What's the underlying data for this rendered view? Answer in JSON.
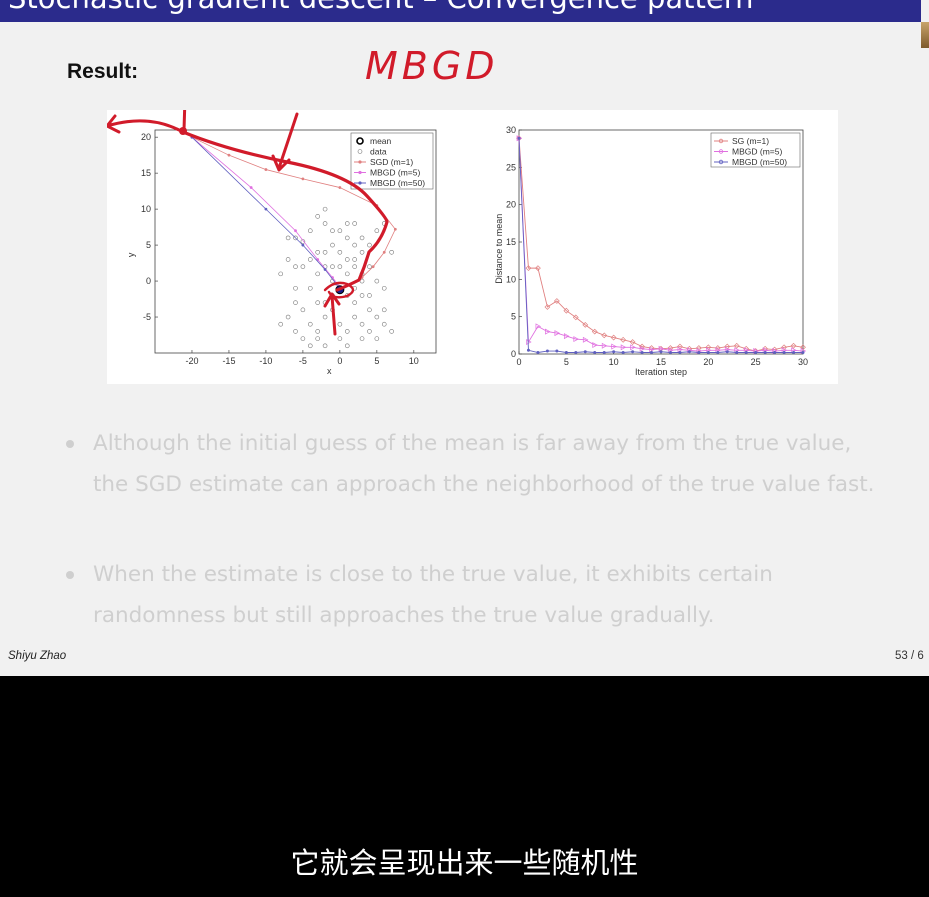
{
  "slide": {
    "title": "Stochastic gradient descent – Convergence pattern",
    "result_label": "Result:",
    "handwritten_note": "MBGD",
    "bullets": [
      "Although the initial guess of the mean is far away from the true value, the SGD estimate can approach the neighborhood of the true value fast.",
      "When the estimate is close to the true value, it exhibits certain randomness but still approaches the true value gradually."
    ],
    "author": "Shiyu Zhao",
    "page": "53 / 6"
  },
  "subtitle": "它就会呈现出来一些随机性",
  "colors": {
    "title_bar": "#2b2b8c",
    "sgd": "#e08080",
    "mbgd5": "#e070e0",
    "mbgd50": "#6060c0",
    "annotation": "#d11b2a"
  },
  "chart_data": [
    {
      "type": "scatter",
      "xlabel": "x",
      "ylabel": "y",
      "xlim": [
        -25,
        13
      ],
      "ylim": [
        -10,
        21
      ],
      "xticks": [
        -20,
        -15,
        -10,
        -5,
        0,
        5,
        10
      ],
      "yticks": [
        -5,
        0,
        5,
        10,
        15,
        20
      ],
      "legend_position": "top-right",
      "legend": [
        "mean",
        "data",
        "SGD (m=1)",
        "MBGD (m=5)",
        "MBGD (m=50)"
      ],
      "mean": [
        0,
        -1.2
      ],
      "data": [
        [
          -6,
          6
        ],
        [
          -5,
          5.5
        ],
        [
          -4,
          7
        ],
        [
          -3,
          9
        ],
        [
          -2,
          8
        ],
        [
          -1,
          7
        ],
        [
          0,
          7
        ],
        [
          1,
          6
        ],
        [
          2,
          5
        ],
        [
          3,
          6
        ],
        [
          -1,
          5
        ],
        [
          -2,
          4
        ],
        [
          -3,
          4
        ],
        [
          -4,
          3
        ],
        [
          1,
          3
        ],
        [
          2,
          3
        ],
        [
          3,
          4
        ],
        [
          4,
          5
        ],
        [
          5,
          7
        ],
        [
          6,
          8
        ],
        [
          -6,
          2
        ],
        [
          -5,
          2
        ],
        [
          -2,
          2
        ],
        [
          0,
          2
        ],
        [
          1,
          1
        ],
        [
          2,
          2
        ],
        [
          3,
          1
        ],
        [
          4,
          2
        ],
        [
          -8,
          1
        ],
        [
          -7,
          3
        ],
        [
          5,
          0
        ],
        [
          6,
          -1
        ],
        [
          -3,
          1
        ],
        [
          -1,
          0
        ],
        [
          0,
          -1
        ],
        [
          1,
          -2
        ],
        [
          2,
          -1
        ],
        [
          3,
          0
        ],
        [
          -6,
          -3
        ],
        [
          -5,
          -4
        ],
        [
          -4,
          -6
        ],
        [
          -3,
          -7
        ],
        [
          -2,
          -5
        ],
        [
          -1,
          -4
        ],
        [
          0,
          -6
        ],
        [
          1,
          -7
        ],
        [
          2,
          -5
        ],
        [
          3,
          -6
        ],
        [
          4,
          -4
        ],
        [
          5,
          -5
        ],
        [
          6,
          -4
        ],
        [
          -6,
          -7
        ],
        [
          -5,
          -8
        ],
        [
          -4,
          -9
        ],
        [
          -3,
          -8
        ],
        [
          -2,
          -9
        ],
        [
          0,
          -8
        ],
        [
          1,
          -9
        ],
        [
          3,
          -8
        ],
        [
          4,
          -7
        ],
        [
          5,
          -8
        ],
        [
          6,
          -6
        ],
        [
          -7,
          -5
        ],
        [
          -8,
          -6
        ],
        [
          7,
          -7
        ],
        [
          -1,
          -2
        ],
        [
          -2,
          -3
        ],
        [
          2,
          -3
        ],
        [
          -4,
          -1
        ],
        [
          4,
          -2
        ],
        [
          -7,
          6
        ],
        [
          7,
          4
        ],
        [
          -6,
          -1
        ],
        [
          -2,
          10
        ],
        [
          1,
          8
        ],
        [
          3,
          -2
        ],
        [
          -3,
          -3
        ],
        [
          0,
          4
        ],
        [
          -1,
          2
        ],
        [
          2,
          8
        ]
      ],
      "series": [
        {
          "name": "SGD (m=1)",
          "points": [
            [
              -20,
              20
            ],
            [
              -15,
              17.5
            ],
            [
              -10,
              15.5
            ],
            [
              -5,
              14.2
            ],
            [
              0,
              13
            ],
            [
              5,
              10.5
            ],
            [
              7.5,
              7.2
            ],
            [
              6,
              4
            ],
            [
              4.5,
              2
            ],
            [
              3,
              0.5
            ],
            [
              1,
              -0.5
            ],
            [
              0,
              -1.2
            ]
          ]
        },
        {
          "name": "MBGD (m=5)",
          "points": [
            [
              -20,
              20
            ],
            [
              -12,
              13
            ],
            [
              -6,
              7
            ],
            [
              -3,
              3
            ],
            [
              -1,
              0.5
            ],
            [
              0,
              -0.8
            ],
            [
              0.3,
              -1.3
            ],
            [
              0,
              -1.2
            ]
          ]
        },
        {
          "name": "MBGD (m=50)",
          "points": [
            [
              -20,
              20
            ],
            [
              -10,
              10
            ],
            [
              -5,
              5
            ],
            [
              -2,
              1.6
            ],
            [
              -0.5,
              -0.4
            ],
            [
              0,
              -1.1
            ],
            [
              0,
              -1.2
            ]
          ]
        }
      ]
    },
    {
      "type": "line",
      "xlabel": "Iteration step",
      "ylabel": "Distance to mean",
      "xlim": [
        0,
        30
      ],
      "ylim": [
        0,
        30
      ],
      "xticks": [
        0,
        5,
        10,
        15,
        20,
        25,
        30
      ],
      "yticks": [
        0,
        5,
        10,
        15,
        20,
        25,
        30
      ],
      "legend_position": "top-right",
      "legend": [
        "SG (m=1)",
        "MBGD (m=5)",
        "MBGD (m=50)"
      ],
      "x": [
        0,
        1,
        2,
        3,
        4,
        5,
        6,
        7,
        8,
        9,
        10,
        11,
        12,
        13,
        14,
        15,
        16,
        17,
        18,
        19,
        20,
        21,
        22,
        23,
        24,
        25,
        26,
        27,
        28,
        29,
        30
      ],
      "series": [
        {
          "name": "SG (m=1)",
          "values": [
            28.9,
            11.5,
            11.5,
            6.3,
            7.1,
            5.8,
            4.9,
            3.9,
            3.0,
            2.5,
            2.2,
            1.9,
            1.6,
            1.0,
            0.8,
            0.7,
            0.8,
            1.0,
            0.7,
            0.8,
            0.9,
            0.8,
            1.0,
            1.1,
            0.7,
            0.4,
            0.7,
            0.6,
            0.9,
            1.1,
            0.9
          ]
        },
        {
          "name": "MBGD (m=5)",
          "values": [
            28.9,
            1.6,
            3.7,
            3.0,
            2.8,
            2.4,
            2.0,
            1.9,
            1.2,
            1.1,
            1.0,
            0.9,
            0.9,
            0.7,
            0.6,
            0.7,
            0.5,
            0.6,
            0.5,
            0.4,
            0.5,
            0.5,
            0.6,
            0.5,
            0.5,
            0.4,
            0.5,
            0.4,
            0.5,
            0.5,
            0.4
          ]
        },
        {
          "name": "MBGD (m=50)",
          "values": [
            28.9,
            0.5,
            0.2,
            0.4,
            0.4,
            0.2,
            0.2,
            0.3,
            0.2,
            0.2,
            0.3,
            0.2,
            0.3,
            0.2,
            0.2,
            0.3,
            0.2,
            0.2,
            0.3,
            0.2,
            0.2,
            0.2,
            0.3,
            0.2,
            0.2,
            0.2,
            0.2,
            0.2,
            0.2,
            0.2,
            0.2
          ]
        }
      ]
    }
  ]
}
